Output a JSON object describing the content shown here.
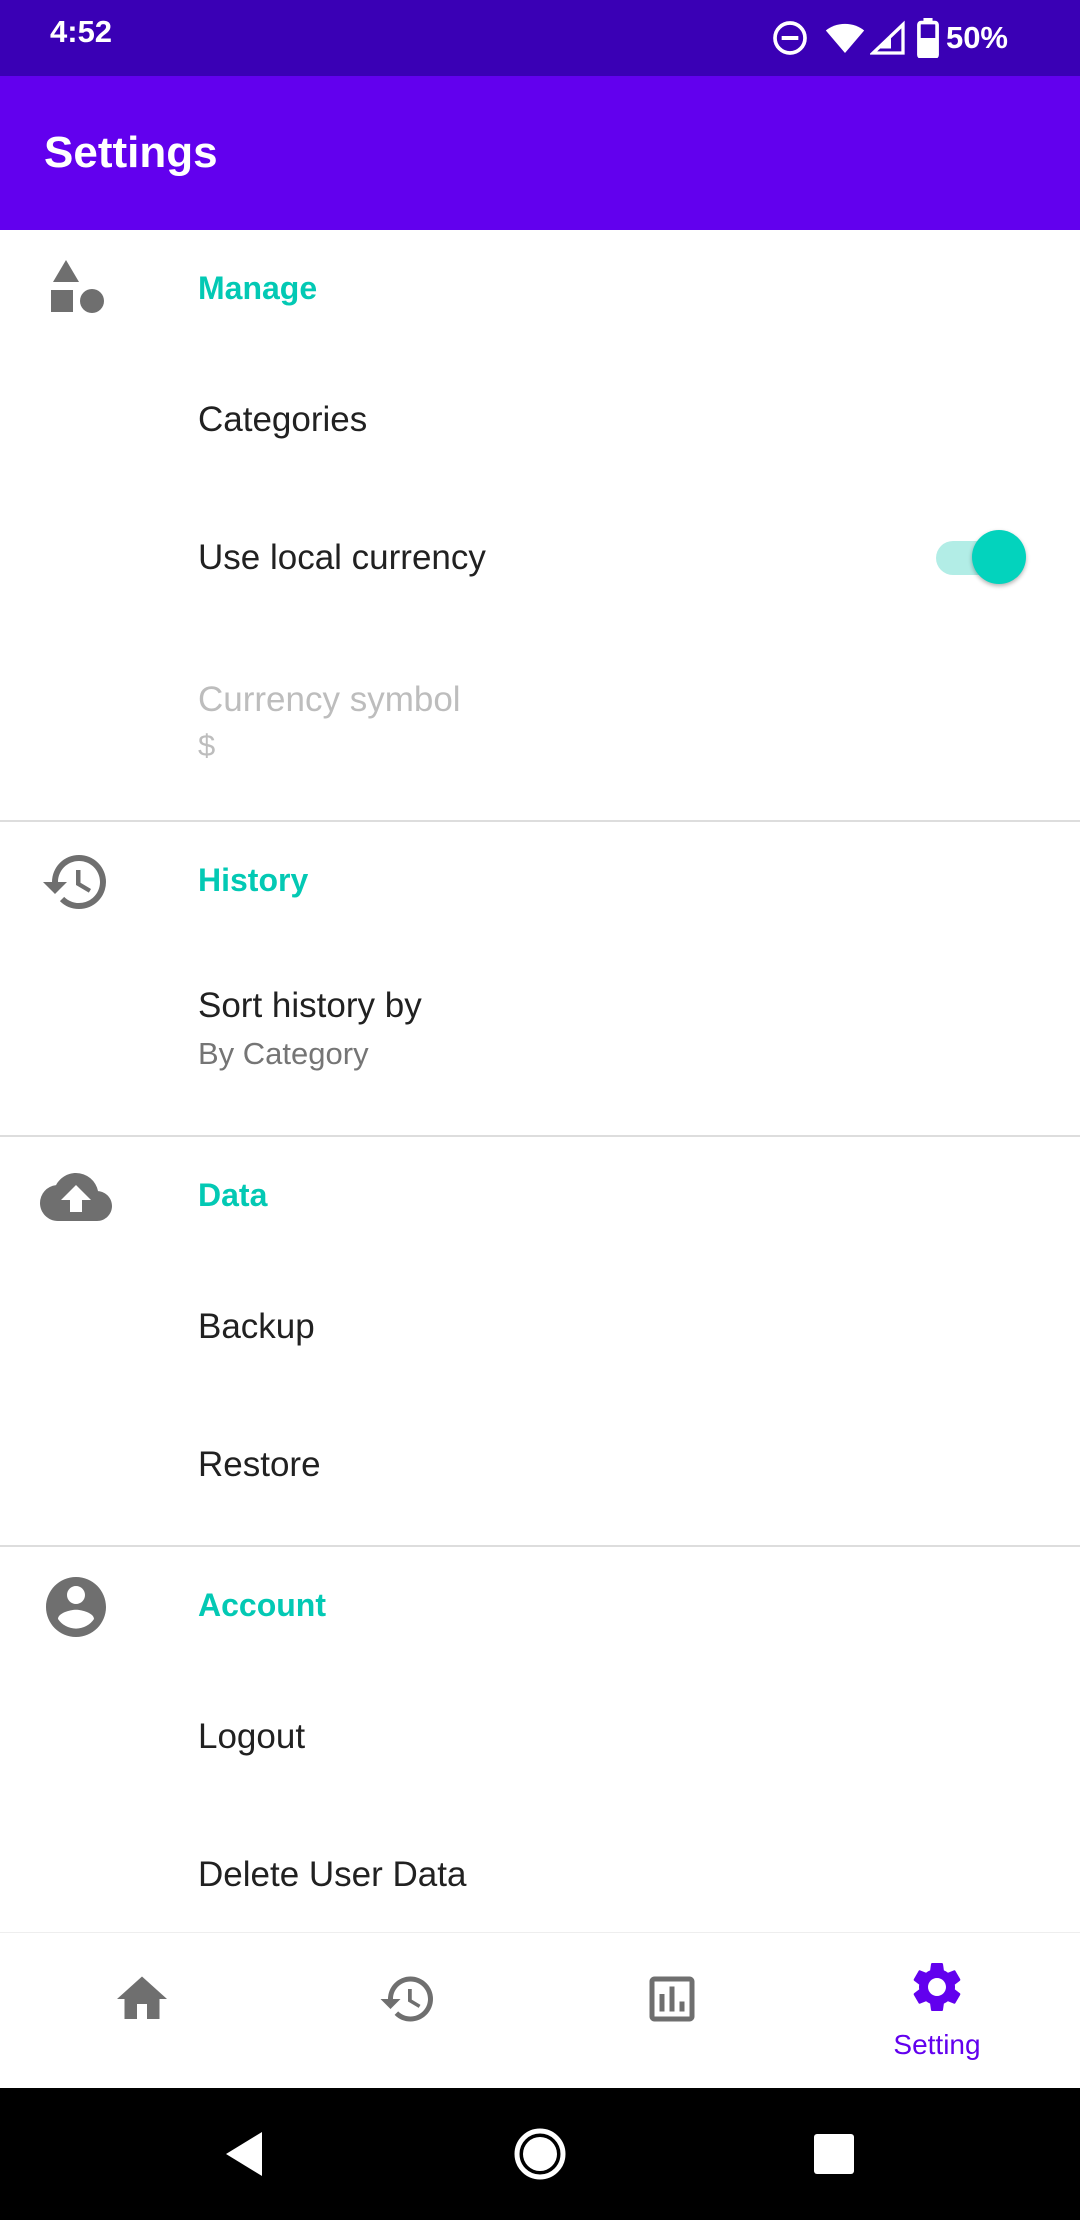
{
  "status_bar": {
    "time": "4:52",
    "battery": "50%"
  },
  "app_bar": {
    "title": "Settings"
  },
  "sections": {
    "manage": {
      "title": "Manage",
      "categories": "Categories",
      "local_currency": "Use local currency",
      "local_currency_enabled": true,
      "currency_symbol_title": "Currency symbol",
      "currency_symbol_value": "$"
    },
    "history": {
      "title": "History",
      "sort_title": "Sort history by",
      "sort_value": "By Category"
    },
    "data": {
      "title": "Data",
      "backup": "Backup",
      "restore": "Restore"
    },
    "account": {
      "title": "Account",
      "logout": "Logout",
      "delete_user_data": "Delete User Data"
    }
  },
  "bottom_nav": {
    "items": [
      {
        "icon": "home-icon"
      },
      {
        "icon": "history-icon"
      },
      {
        "icon": "chart-icon"
      },
      {
        "icon": "gear-icon",
        "label": "Setting"
      }
    ],
    "active_index": 3
  },
  "colors": {
    "status_bar": "#3a00b5",
    "app_bar": "#6200ee",
    "accent": "#03c9b4",
    "icon_gray": "#6f6f6f"
  }
}
